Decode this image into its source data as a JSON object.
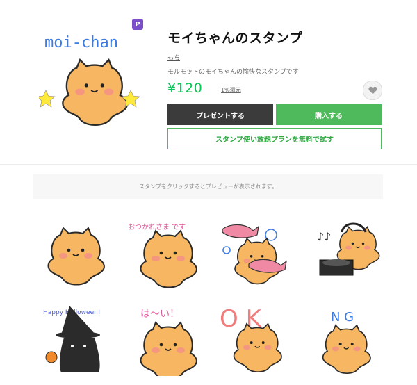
{
  "product": {
    "title": "モイちゃんのスタンプ",
    "author": "もち",
    "description": "モルモットのモイちゃんの愉快なスタンプです",
    "price": "¥120",
    "rebate": "1%還元",
    "premium_badge": "P",
    "hero_text": "moi-chan"
  },
  "actions": {
    "gift_label": "プレゼントする",
    "buy_label": "購入する",
    "trial_label": "スタンプ使い放題プランを無料で試す"
  },
  "hint": "スタンプをクリックするとプレビューが表示されます。",
  "stickers": [
    {
      "text": ""
    },
    {
      "text": "おつかれさま です"
    },
    {
      "text": ""
    },
    {
      "text": ""
    },
    {
      "text": "Happy Halloween!"
    },
    {
      "text": "は～い！"
    },
    {
      "text": "O K"
    },
    {
      "text": "N G"
    }
  ],
  "colors": {
    "accent": "#06c755",
    "buy": "#4fba5c",
    "gift": "#3b3b3b",
    "premium": "#7b4fc8",
    "body": "#f7b661"
  }
}
